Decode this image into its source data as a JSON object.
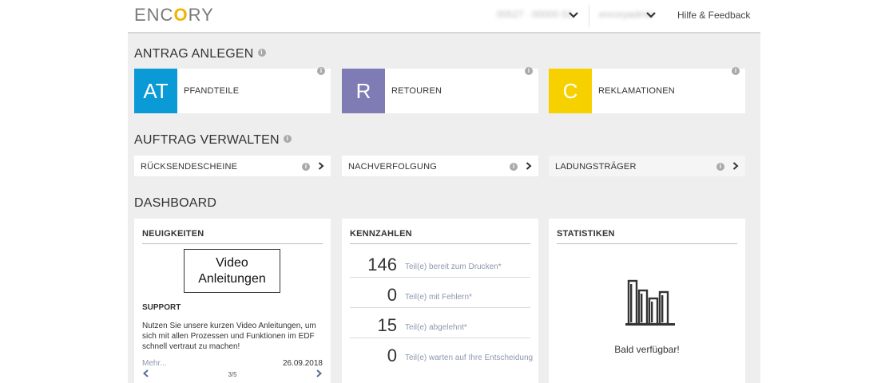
{
  "header": {
    "logo_text": "ENCORY",
    "account_number": "00527 · 00000 02",
    "user_name": "encoryadmin",
    "help_label": "Hilfe & Feedback"
  },
  "antrag": {
    "title": "ANTRAG ANLEGEN",
    "tiles": [
      {
        "badge": "AT",
        "label": "PFANDTEILE",
        "color": "#0a9ad6"
      },
      {
        "badge": "R",
        "label": "RETOUREN",
        "color": "#7f7bb5"
      },
      {
        "badge": "C",
        "label": "REKLAMATIONEN",
        "color": "#f7d000"
      }
    ]
  },
  "auftrag": {
    "title": "AUFTRAG VERWALTEN",
    "items": [
      {
        "label": "RÜCKSENDESCHEINE"
      },
      {
        "label": "NACHVERFOLGUNG"
      },
      {
        "label": "LADUNGSTRÄGER"
      }
    ]
  },
  "dashboard": {
    "title": "DASHBOARD",
    "news": {
      "header": "NEUIGKEITEN",
      "video_line1": "Video",
      "video_line2": "Anleitungen",
      "subtitle": "SUPPORT",
      "text": "Nutzen Sie unsere kurzen Video Anleitungen, um sich mit allen Prozessen und Funktionen im EDF schnell vertraut zu machen!",
      "more_label": "Mehr...",
      "date": "26.09.2018",
      "pager": "3/5"
    },
    "kennzahlen": {
      "header": "KENNZAHLEN",
      "rows": [
        {
          "value": "146",
          "label": "Teil(e) bereit zum Drucken*"
        },
        {
          "value": "0",
          "label": "Teil(e) mit Fehlern*"
        },
        {
          "value": "15",
          "label": "Teil(e) abgelehnt*"
        },
        {
          "value": "0",
          "label": "Teil(e) warten auf Ihre Entscheidung"
        }
      ]
    },
    "statistiken": {
      "header": "STATISTIKEN",
      "text": "Bald verfügbar!"
    }
  },
  "icons": {
    "info": "info-icon",
    "chevron_down": "chevron-down-icon",
    "chevron_right": "chevron-right-icon",
    "chart": "bar-chart-icon"
  }
}
